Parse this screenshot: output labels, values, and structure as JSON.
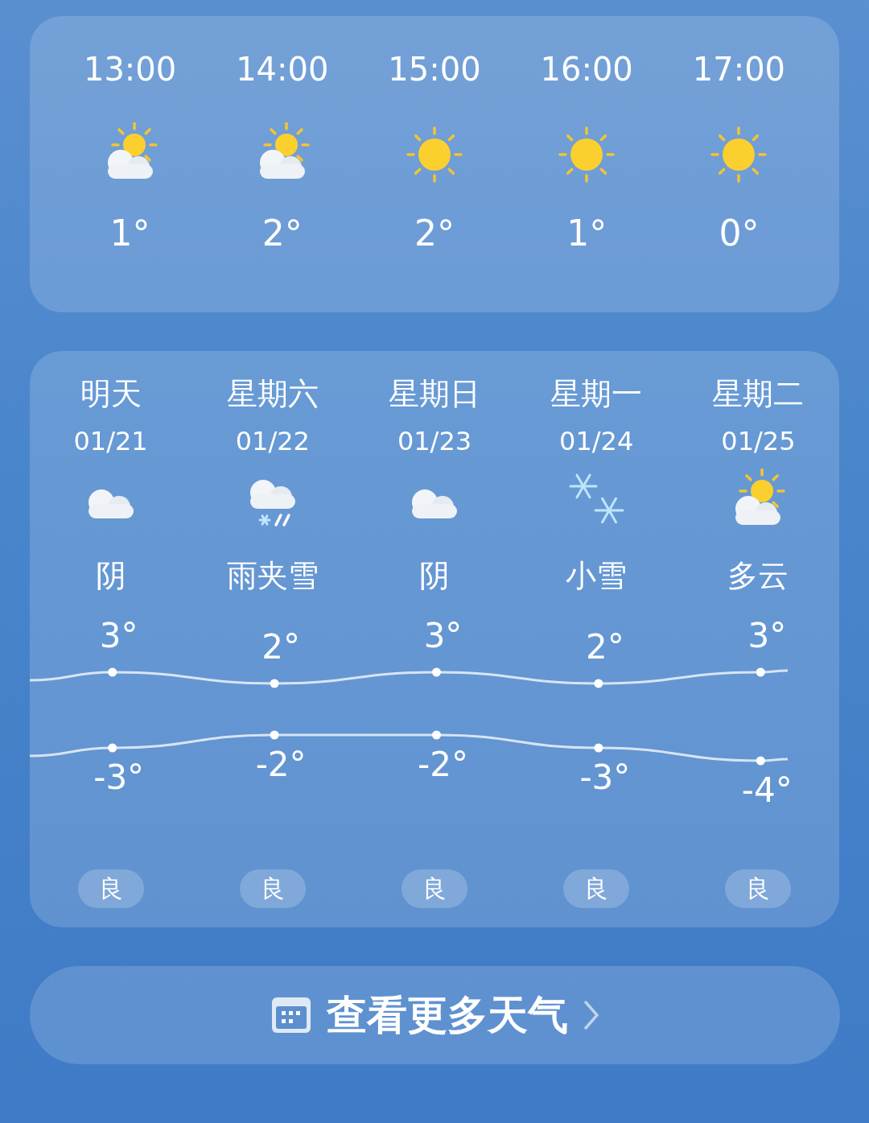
{
  "hourly": [
    {
      "time": "13:00",
      "kind": "partly_cloudy",
      "temp": "1°"
    },
    {
      "time": "14:00",
      "kind": "partly_cloudy",
      "temp": "2°"
    },
    {
      "time": "15:00",
      "kind": "sun",
      "temp": "2°"
    },
    {
      "time": "16:00",
      "kind": "sun",
      "temp": "1°"
    },
    {
      "time": "17:00",
      "kind": "sun",
      "temp": "0°"
    }
  ],
  "daily": [
    {
      "day": "明天",
      "date": "01/21",
      "kind": "cloudy",
      "condition": "阴",
      "high": "3°",
      "low": "-3°",
      "air": "良"
    },
    {
      "day": "星期六",
      "date": "01/22",
      "kind": "sleet",
      "condition": "雨夹雪",
      "high": "2°",
      "low": "-2°",
      "air": "良"
    },
    {
      "day": "星期日",
      "date": "01/23",
      "kind": "cloudy",
      "condition": "阴",
      "high": "3°",
      "low": "-2°",
      "air": "良"
    },
    {
      "day": "星期一",
      "date": "01/24",
      "kind": "snow",
      "condition": "小雪",
      "high": "2°",
      "low": "-3°",
      "air": "良"
    },
    {
      "day": "星期二",
      "date": "01/25",
      "kind": "partly_cloudy",
      "condition": "多云",
      "high": "3°",
      "low": "-4°",
      "air": "良"
    }
  ],
  "more_button": {
    "label": "查看更多天气"
  }
}
